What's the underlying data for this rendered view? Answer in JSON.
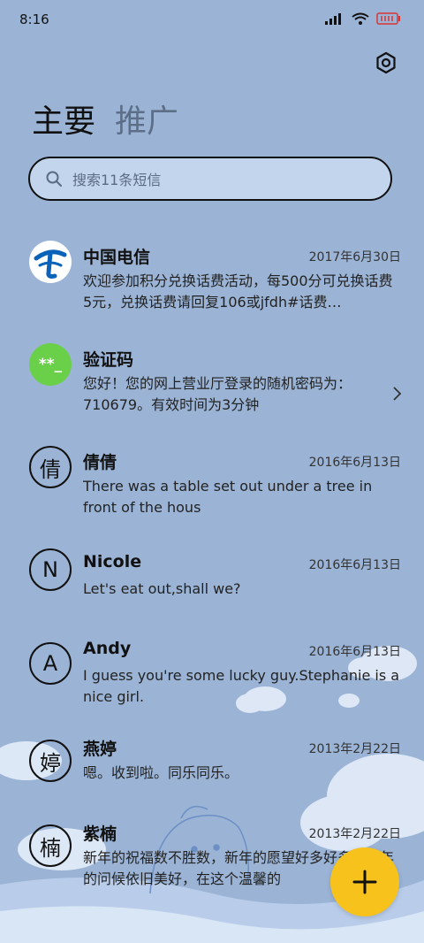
{
  "status": {
    "time": "8:16"
  },
  "tabs": [
    {
      "label": "主要"
    },
    {
      "label": "推广"
    }
  ],
  "search": {
    "placeholder": "搜索11条短信"
  },
  "messages": [
    {
      "name": "中国电信",
      "date": "2017年6月30日",
      "snippet": "欢迎参加积分兑换话费活动，每500分可兑换话费5元，兑换话费请回复106或jfdh#话费…",
      "avatar": "telecom-logo"
    },
    {
      "name": "验证码",
      "date": "",
      "snippet": "您好！您的网上营业厅登录的随机密码为：710679。有效时间为3分钟",
      "avatar_text": "**_"
    },
    {
      "name": "倩倩",
      "date": "2016年6月13日",
      "snippet": "There was a table set out under a tree in front of the hous",
      "avatar_text": "倩"
    },
    {
      "name": "Nicole",
      "date": "2016年6月13日",
      "snippet": "Let's eat out,shall we?",
      "avatar_text": "N"
    },
    {
      "name": "Andy",
      "date": "2016年6月13日",
      "snippet": "I guess you're some lucky guy.Stephanie is a nice girl.",
      "avatar_text": "A"
    },
    {
      "name": "燕婷",
      "date": "2013年2月22日",
      "snippet": "嗯。收到啦。同乐同乐。",
      "avatar_text": "婷"
    },
    {
      "name": "紫楠",
      "date": "2013年2月22日",
      "snippet": "新年的祝福数不胜数，新年的愿望好多好多，新年的问候依旧美好，在这个温馨的",
      "avatar_text": "楠"
    }
  ],
  "colors": {
    "background": "#9bb4d6",
    "fab": "#f7c21b",
    "verify_avatar": "#6ad04a",
    "telecom_blue": "#0a63b8"
  },
  "icons": {
    "settings": "gear-icon",
    "search": "search-icon",
    "compose": "plus-icon",
    "chevron": "chevron-right-icon"
  }
}
